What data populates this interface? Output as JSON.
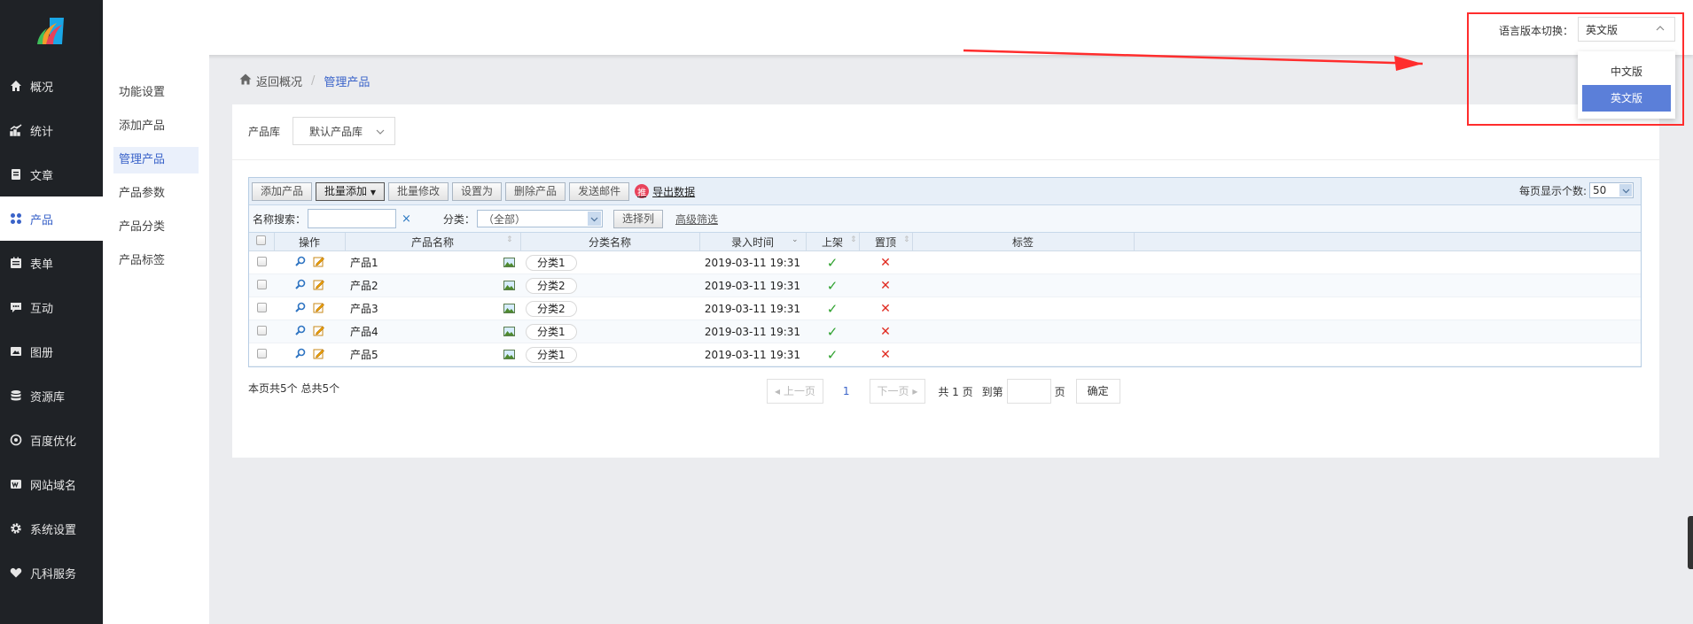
{
  "sidebar": {
    "items": [
      {
        "label": "概况",
        "icon": "home-icon"
      },
      {
        "label": "统计",
        "icon": "chart-icon"
      },
      {
        "label": "文章",
        "icon": "document-icon"
      },
      {
        "label": "产品",
        "icon": "grid-icon",
        "active": true
      },
      {
        "label": "表单",
        "icon": "form-icon"
      },
      {
        "label": "互动",
        "icon": "chat-icon"
      },
      {
        "label": "图册",
        "icon": "image-icon"
      },
      {
        "label": "资源库",
        "icon": "database-icon"
      },
      {
        "label": "百度优化",
        "icon": "seo-icon"
      },
      {
        "label": "网站域名",
        "icon": "domain-icon"
      },
      {
        "label": "系统设置",
        "icon": "gear-icon"
      },
      {
        "label": "凡科服务",
        "icon": "heart-icon"
      }
    ]
  },
  "header": {
    "lang_label": "语言版本切换：",
    "lang_selected": "英文版",
    "lang_options": [
      "中文版",
      "英文版"
    ]
  },
  "subnav": {
    "items": [
      "功能设置",
      "添加产品",
      "管理产品",
      "产品参数",
      "产品分类",
      "产品标签"
    ]
  },
  "breadcrumb": {
    "home": "返回概况",
    "sep": "/",
    "current": "管理产品"
  },
  "library": {
    "label": "产品库",
    "selected": "默认产品库"
  },
  "toolbar": {
    "buttons": [
      "添加产品",
      "批量添加",
      "批量修改",
      "设置为",
      "删除产品",
      "发送邮件"
    ],
    "export_badge": "推",
    "export_label": "导出数据",
    "perpage_label": "每页显示个数:",
    "perpage_value": "50"
  },
  "filter": {
    "search_label": "名称搜索：",
    "search_value": "",
    "clear": "×",
    "category_label": "分类：",
    "category_value": "（全部）",
    "select_columns": "选择列",
    "advanced": "高级筛选"
  },
  "table": {
    "headers": [
      "操作",
      "产品名称",
      "分类名称",
      "录入时间",
      "上架",
      "置顶",
      "标签"
    ],
    "rows": [
      {
        "name": "产品1",
        "category": "分类1",
        "time": "2019-03-11 19:31",
        "on_shelf": "✓",
        "top": "✕"
      },
      {
        "name": "产品2",
        "category": "分类2",
        "time": "2019-03-11 19:31",
        "on_shelf": "✓",
        "top": "✕"
      },
      {
        "name": "产品3",
        "category": "分类2",
        "time": "2019-03-11 19:31",
        "on_shelf": "✓",
        "top": "✕"
      },
      {
        "name": "产品4",
        "category": "分类1",
        "time": "2019-03-11 19:31",
        "on_shelf": "✓",
        "top": "✕"
      },
      {
        "name": "产品5",
        "category": "分类1",
        "time": "2019-03-11 19:31",
        "on_shelf": "✓",
        "top": "✕"
      }
    ]
  },
  "pager": {
    "summary": "本页共5个 总共5个",
    "prev": "上一页",
    "current": "1",
    "next": "下一页",
    "total": "共 1 页",
    "goto": "到第",
    "page_unit": "页",
    "confirm": "确定"
  },
  "colors": {
    "sidebar_bg": "#1f2226",
    "accent": "#3a63c9",
    "selected_option": "#5b7fd9",
    "annotation": "#ff2d2d"
  }
}
